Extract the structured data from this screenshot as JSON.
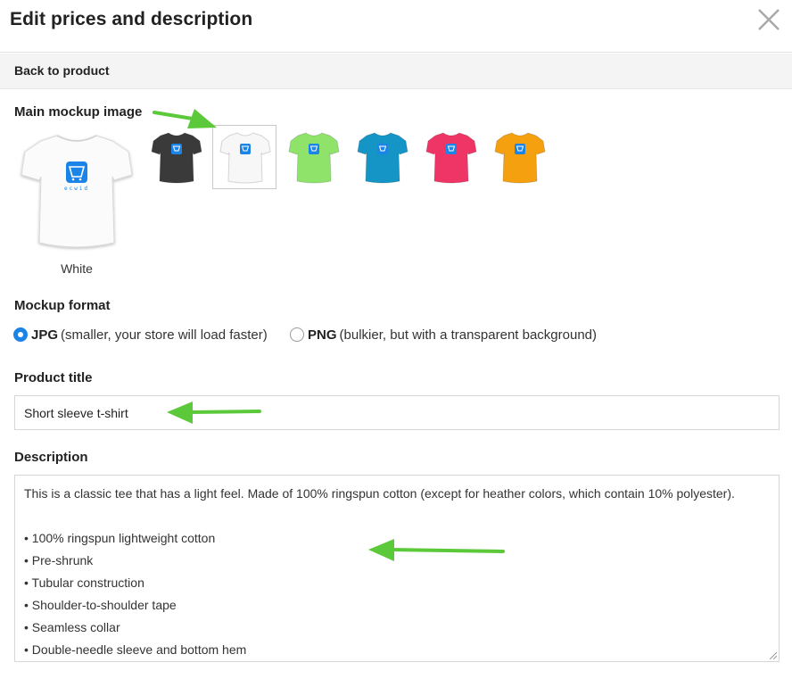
{
  "header": {
    "title": "Edit prices and description",
    "close_icon": "close-icon"
  },
  "nav": {
    "back_label": "Back to product"
  },
  "mockup": {
    "section_label": "Main mockup image",
    "selected_caption": "White",
    "swatches": [
      {
        "name": "Black",
        "color": "#3a3a3a"
      },
      {
        "name": "White",
        "color": "#f7f7f7",
        "selected": true
      },
      {
        "name": "Green",
        "color": "#8fe36a"
      },
      {
        "name": "Blue",
        "color": "#1495c6"
      },
      {
        "name": "Pink",
        "color": "#ef3566"
      },
      {
        "name": "Orange",
        "color": "#f5a00e"
      }
    ],
    "logo_color": "#1b84e7"
  },
  "format": {
    "section_label": "Mockup format",
    "options": [
      {
        "key": "JPG",
        "note": "(smaller, your store will load faster)",
        "checked": true
      },
      {
        "key": "PNG",
        "note": "(bulkier, but with a transparent background)",
        "checked": false
      }
    ]
  },
  "title_field": {
    "label": "Product title",
    "value": "Short sleeve t-shirt"
  },
  "description": {
    "label": "Description",
    "lines": [
      "This is a classic tee that has a light feel. Made of 100% ringspun cotton (except for heather colors, which contain 10% polyester).",
      "",
      "• 100% ringspun lightweight cotton",
      "• Pre-shrunk",
      "• Tubular construction",
      "• Shoulder-to-shoulder tape",
      "• Seamless collar",
      "• Double-needle sleeve and bottom hem"
    ]
  },
  "accent_colors": {
    "radio_checked": "#1b84e7",
    "annotation_arrow": "#5cc93a"
  }
}
